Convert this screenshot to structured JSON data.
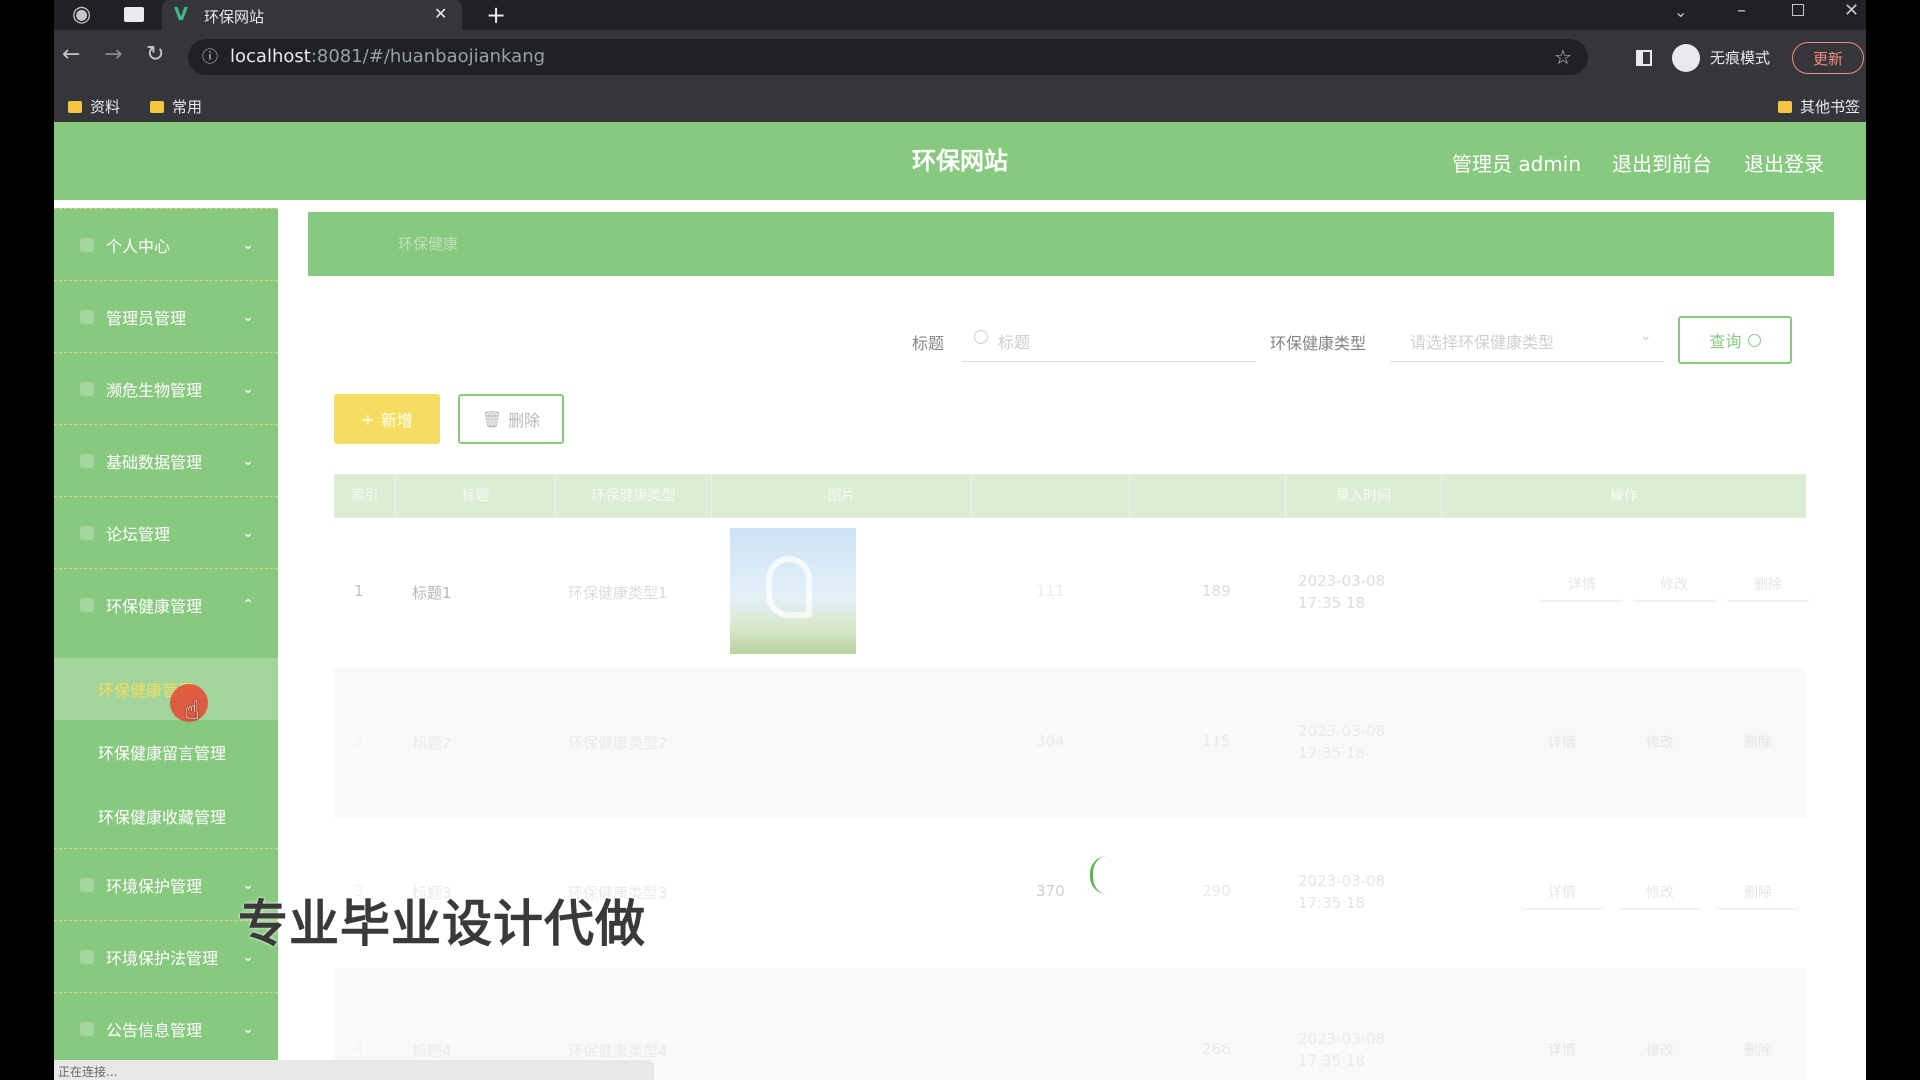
{
  "browser": {
    "tab_title": "环保网站",
    "url_host": "localhost",
    "url_rest": ":8081/#/huanbaojiankang",
    "incognito_label": "无痕模式",
    "update_label": "更新",
    "bookmarks": [
      "资料",
      "常用"
    ],
    "other_bookmarks": "其他书签",
    "status_text": "正在连接..."
  },
  "header": {
    "title": "环保网站",
    "admin_label": "管理员 admin",
    "front_link": "退出到前台",
    "logout_link": "退出登录"
  },
  "sidebar": {
    "items": [
      {
        "label": "个人中心",
        "expanded": false
      },
      {
        "label": "管理员管理",
        "expanded": false
      },
      {
        "label": "濒危生物管理",
        "expanded": false
      },
      {
        "label": "基础数据管理",
        "expanded": false
      },
      {
        "label": "论坛管理",
        "expanded": false
      },
      {
        "label": "环保健康管理",
        "expanded": true
      },
      {
        "label": "环境保护管理",
        "expanded": false
      },
      {
        "label": "环境保护法管理",
        "expanded": false
      },
      {
        "label": "公告信息管理",
        "expanded": false
      }
    ],
    "sub_items": [
      "环保健康管理",
      "环保健康留言管理",
      "环保健康收藏管理"
    ]
  },
  "breadcrumb": {
    "text": "环保健康"
  },
  "search": {
    "title_label": "标题",
    "title_placeholder": "标题",
    "type_label": "环保健康类型",
    "type_placeholder": "请选择环保健康类型",
    "query_button": "查询"
  },
  "actions": {
    "add_button": "新增",
    "delete_button": "删除"
  },
  "table": {
    "headers": [
      "索引",
      "标题",
      "环保健康类型",
      "图片",
      "",
      "",
      "录入时间",
      "操作"
    ],
    "rows": [
      {
        "index": "1",
        "title": "标题1",
        "type": "环保健康类型1",
        "time": "2023-03-08 17:35 18",
        "views": "111",
        "num": "189"
      },
      {
        "index": "2",
        "title": "标题2",
        "type": "环保健康类型2",
        "time": "2023-03-08 17:35 18",
        "views": "304",
        "num": "115"
      },
      {
        "index": "3",
        "title": "标题3",
        "type": "环保健康类型3",
        "time": "2023-03-08 17:35 18",
        "views": "370",
        "num": "290"
      },
      {
        "index": "4",
        "title": "标题4",
        "type": "环保健康类型4",
        "time": "2023-03-08 17:35 18",
        "views": "",
        "num": "266"
      }
    ],
    "row_actions": [
      "详情",
      "修改",
      "删除"
    ]
  },
  "watermark": "专业毕业设计代做",
  "colors": {
    "accent": "#5bb44f",
    "add_button": "#f2d024"
  }
}
